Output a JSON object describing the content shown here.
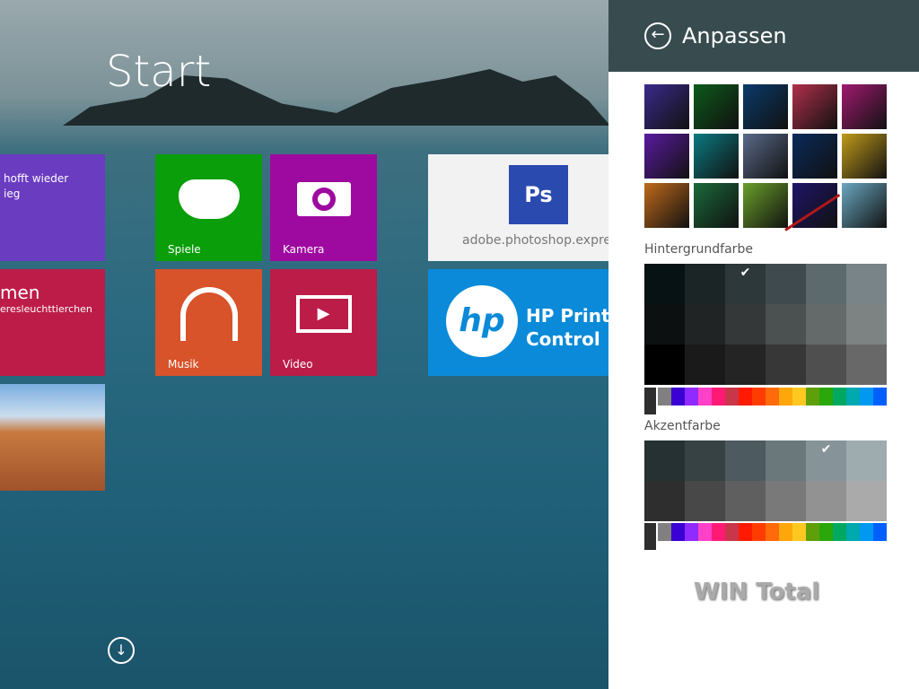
{
  "start": {
    "title": "Start"
  },
  "tiles": {
    "news": {
      "text1": "hofft wieder",
      "text2": "ieg"
    },
    "travel": {
      "title": "men",
      "sub": "eresleuchttierchen"
    },
    "games": {
      "label": "Spiele",
      "color": "#0a9e0a"
    },
    "camera": {
      "label": "Kamera",
      "color": "#9e0aa0"
    },
    "music": {
      "label": "Musik",
      "color": "#d8522a"
    },
    "video": {
      "label": "Video",
      "color": "#bb1c48"
    },
    "photoshop": {
      "label": "adobe.photoshop.express",
      "logo": "Ps"
    },
    "hp": {
      "line1": "HP Print",
      "line2": "Control",
      "logo": "hp"
    }
  },
  "panel": {
    "title": "Anpassen",
    "background_label": "Hintergrundfarbe",
    "accent_label": "Akzentfarbe",
    "thumbs": [
      "#3a2a8a",
      "#0c5a1a",
      "#0a3a6a",
      "#b0304a",
      "#a01a70",
      "#5a1aa0",
      "#0a7a80",
      "#5a6a8a",
      "#0a2a5a",
      "#c09a1a",
      "#c06a1a",
      "#1a6a3a",
      "#6aa02a",
      "#1e1468",
      "#6aa8c0"
    ],
    "background_colors": [
      [
        "#061214",
        "#1b2526",
        "#2c3839",
        "#3f4a4e",
        "#5d6a6d",
        "#788487"
      ],
      [
        "#0d1011",
        "#212424",
        "#343838",
        "#4b5050",
        "#646a6a",
        "#7d8383"
      ],
      [
        "#000000",
        "#1a1a1a",
        "#242424",
        "#373737",
        "#4f4f4f",
        "#686868"
      ]
    ],
    "background_selected": [
      0,
      2
    ],
    "accent_colors": [
      [
        "#253133",
        "#364244",
        "#4d5a5f",
        "#6a787b",
        "#86949a",
        "#9eabaf"
      ],
      [
        "#2e2e2e",
        "#484848",
        "#5f5f5f",
        "#797979",
        "#929292",
        "#aaaaaa"
      ]
    ],
    "accent_selected": [
      0,
      4
    ],
    "rainbow": [
      "#808080",
      "#3a00d4",
      "#8f2bff",
      "#ff40c8",
      "#ff1a75",
      "#c8364a",
      "#ff1a00",
      "#ff3c00",
      "#ff6a0a",
      "#ffa60a",
      "#ffc820",
      "#5fa00a",
      "#2aa80a",
      "#00a860",
      "#00a8b0",
      "#0098f0",
      "#0060ff"
    ],
    "watermark": "WIN Total"
  }
}
